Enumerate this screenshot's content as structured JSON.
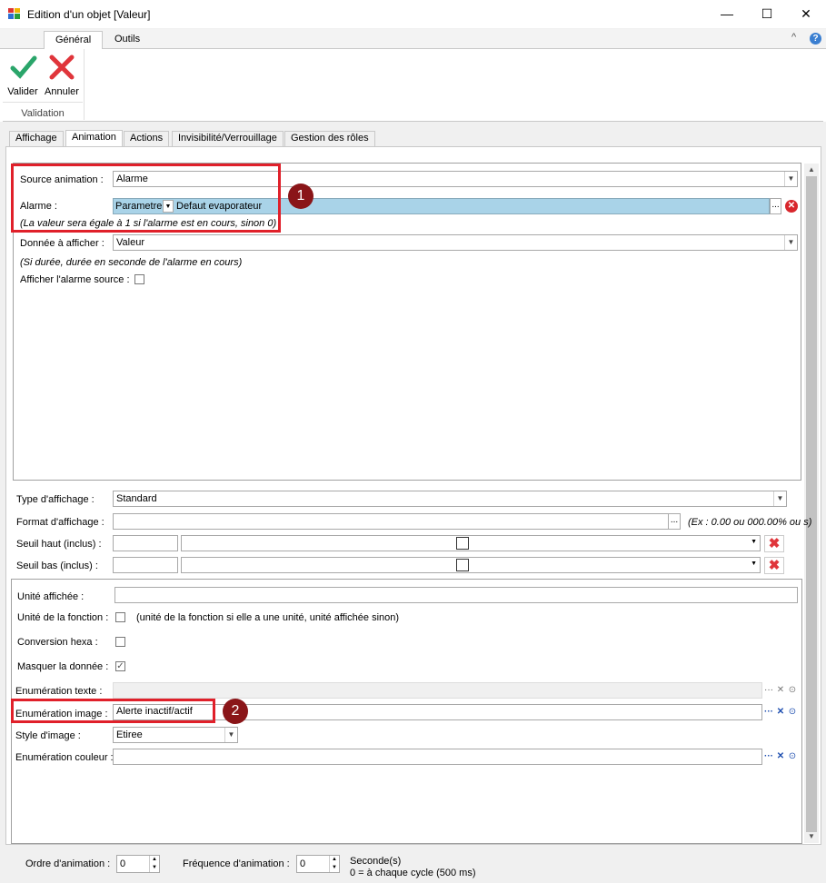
{
  "window": {
    "title": "Edition d'un objet [Valeur]",
    "minimize_glyph": "—",
    "maximize_glyph": "☐",
    "close_glyph": "✕"
  },
  "ribbon": {
    "tabs": [
      {
        "label": "Général",
        "active": true
      },
      {
        "label": "Outils",
        "active": false
      }
    ],
    "buttons": {
      "validate_label": "Valider",
      "cancel_label": "Annuler"
    },
    "group_label": "Validation",
    "collapse_glyph": "^",
    "help_glyph": "?"
  },
  "panel_tabs": [
    {
      "label": "Affichage"
    },
    {
      "label": "Animation"
    },
    {
      "label": "Actions"
    },
    {
      "label": "Invisibilité/Verrouillage"
    },
    {
      "label": "Gestion des rôles"
    }
  ],
  "animation": {
    "source_label": "Source animation :",
    "source_value": "Alarme",
    "alarm_label": "Alarme :",
    "alarm_param": "Parametre",
    "alarm_value": "Defaut evaporateur",
    "alarm_note": "(La valeur sera égale à 1 si l'alarme est en cours, sinon 0)",
    "data_label": "Donnée à afficher :",
    "data_value": "Valeur",
    "data_note": "(Si durée, durée en seconde de l'alarme en cours)",
    "show_source_label": "Afficher l'alarme source :",
    "browse_glyph": "..."
  },
  "display": {
    "type_label": "Type d'affichage :",
    "type_value": "Standard",
    "format_label": "Format d'affichage :",
    "format_value": "",
    "format_hint": "(Ex : 0.00 ou 000.00% ou s)",
    "seuil_haut_label": "Seuil haut (inclus) :",
    "seuil_bas_label": "Seuil bas (inclus) :",
    "unit_label": "Unité affichée :",
    "unit_value": "",
    "unit_function_label": "Unité de la fonction :",
    "unit_function_note": "(unité de la fonction si elle a une unité, unité affichée sinon)",
    "hexa_label": "Conversion hexa :",
    "mask_label": "Masquer la donnée :",
    "mask_checked": true,
    "enum_text_label": "Enumération texte :",
    "enum_image_label": "Enumération image :",
    "enum_image_value": "Alerte inactif/actif",
    "image_style_label": "Style d'image :",
    "image_style_value": "Etiree",
    "enum_color_label": "Enumération couleur :"
  },
  "badges": {
    "one": "1",
    "two": "2"
  },
  "footer": {
    "order_label": "Ordre d'animation :",
    "order_value": "0",
    "freq_label": "Fréquence d'animation :",
    "freq_value": "0",
    "seconds_label": "Seconde(s)",
    "cycle_note": "0 = à chaque cycle (500 ms)"
  },
  "colors": {
    "highlight_red": "#e0202a",
    "badge": "#8a1518",
    "alarm_field_bg": "#a9d3e8",
    "validate_green": "#2aa56a",
    "cancel_red": "#e0353b"
  }
}
